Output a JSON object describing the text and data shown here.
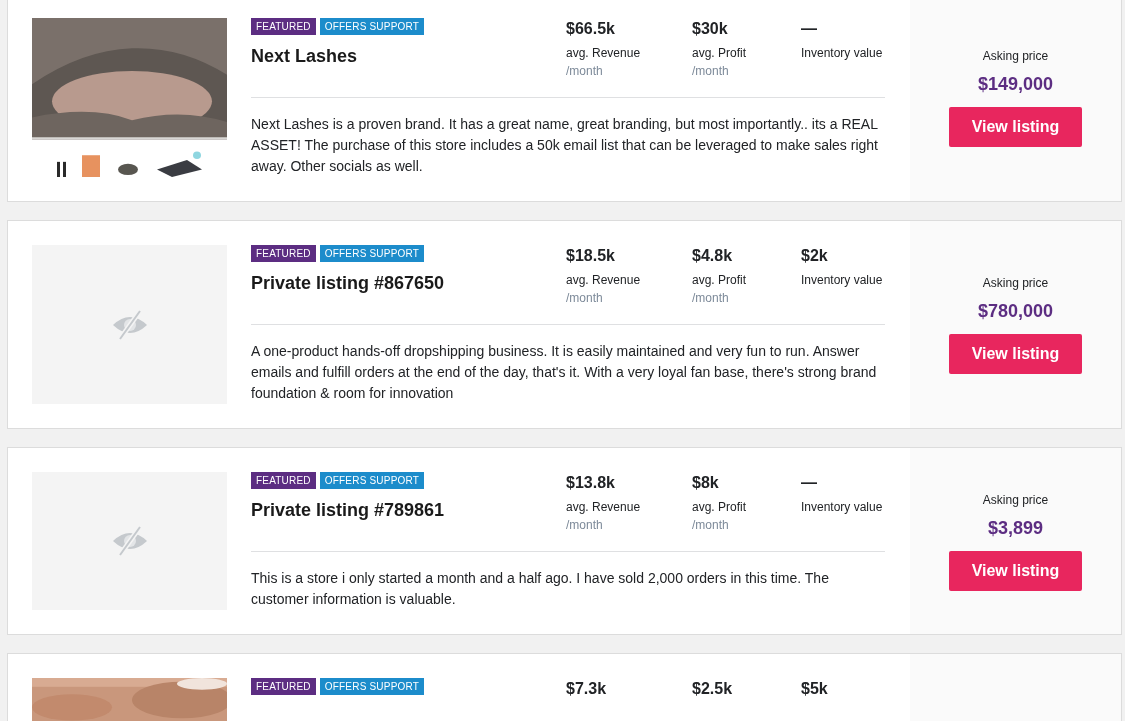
{
  "listings": [
    {
      "image": {
        "kind": "picture"
      },
      "badges": [
        {
          "label": "FEATURED",
          "color": "#5c2d82"
        },
        {
          "label": "OFFERS SUPPORT",
          "color": "#1c8ccb"
        }
      ],
      "title": "Next Lashes",
      "stats": [
        {
          "value": "$66.5k",
          "label": "avg. Revenue",
          "period": "/month"
        },
        {
          "value": "$30k",
          "label": "avg. Profit",
          "period": "/month"
        },
        {
          "value": "—",
          "label": "Inventory value"
        }
      ],
      "description": "Next Lashes is a proven brand. It has a great name, great branding, but most importantly.. its a REAL ASSET! The purchase of this store includes a 50k email list that can be leveraged to make sales right away. Other socials as well.",
      "price_label": "Asking price",
      "price": "$149,000",
      "button": "View listing"
    },
    {
      "image": {
        "kind": "hidden"
      },
      "badges": [
        {
          "label": "FEATURED",
          "color": "#5c2d82"
        },
        {
          "label": "OFFERS SUPPORT",
          "color": "#1c8ccb"
        }
      ],
      "title": "Private listing #867650",
      "stats": [
        {
          "value": "$18.5k",
          "label": "avg. Revenue",
          "period": "/month"
        },
        {
          "value": "$4.8k",
          "label": "avg. Profit",
          "period": "/month"
        },
        {
          "value": "$2k",
          "label": "Inventory value"
        }
      ],
      "description": "A one-product hands-off dropshipping business. It is easily maintained and very fun to run. Answer emails and fulfill orders at the end of the day, that's it. With a very loyal fan base, there's strong brand foundation & room for innovation",
      "price_label": "Asking price",
      "price": "$780,000",
      "button": "View listing"
    },
    {
      "image": {
        "kind": "hidden"
      },
      "badges": [
        {
          "label": "FEATURED",
          "color": "#5c2d82"
        },
        {
          "label": "OFFERS SUPPORT",
          "color": "#1c8ccb"
        }
      ],
      "title": "Private listing #789861",
      "stats": [
        {
          "value": "$13.8k",
          "label": "avg. Revenue",
          "period": "/month"
        },
        {
          "value": "$8k",
          "label": "avg. Profit",
          "period": "/month"
        },
        {
          "value": "—",
          "label": "Inventory value"
        }
      ],
      "description": "This is a store i only started a month and a half ago. I have sold 2,000 orders in this time. The customer information is valuable.",
      "price_label": "Asking price",
      "price": "$3,899",
      "button": "View listing"
    },
    {
      "image": {
        "kind": "blurred"
      },
      "badges": [
        {
          "label": "FEATURED",
          "color": "#5c2d82"
        },
        {
          "label": "OFFERS SUPPORT",
          "color": "#1c8ccb"
        }
      ],
      "stats": [
        {
          "value": "$7.3k"
        },
        {
          "value": "$2.5k"
        },
        {
          "value": "$5k"
        }
      ]
    }
  ]
}
